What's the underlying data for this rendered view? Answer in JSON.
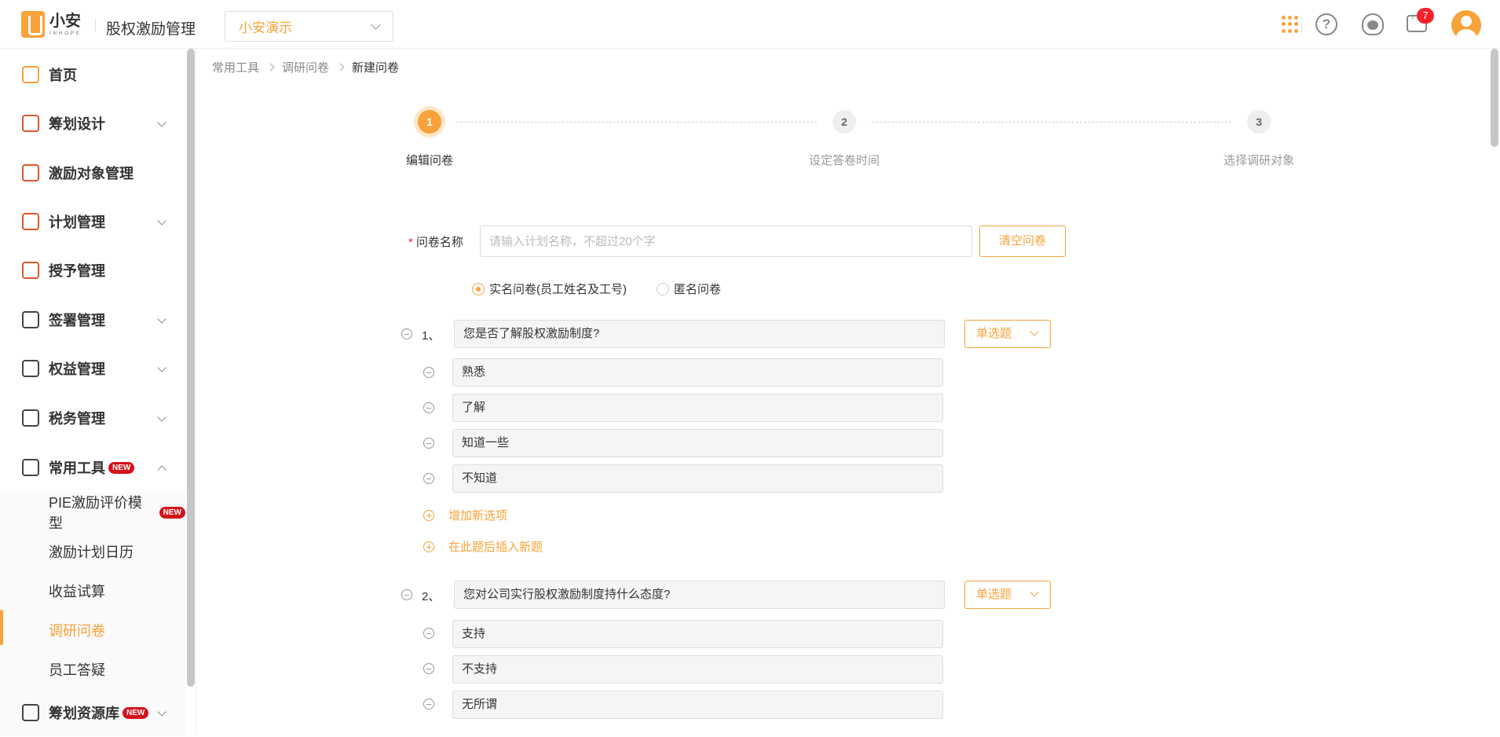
{
  "header": {
    "logo_cn": "小安",
    "logo_en": "INHOPE",
    "app_title": "股权激励管理",
    "org_selected": "小安演示",
    "help_glyph": "?",
    "message_badge": "7",
    "icons": [
      "apps-grid-icon",
      "help-icon",
      "support-headset-icon",
      "message-icon",
      "user-avatar-icon"
    ]
  },
  "sidebar": {
    "items": [
      {
        "label": "首页",
        "icon": "home-icon"
      },
      {
        "label": "筹划设计",
        "icon": "edit-icon"
      },
      {
        "label": "激励对象管理",
        "icon": "people-icon"
      },
      {
        "label": "计划管理",
        "icon": "apps-icon"
      },
      {
        "label": "授予管理",
        "icon": "document-icon"
      },
      {
        "label": "签署管理",
        "icon": "signature-icon"
      },
      {
        "label": "权益管理",
        "icon": "equity-icon"
      },
      {
        "label": "税务管理",
        "icon": "tax-icon"
      },
      {
        "label": "常用工具",
        "icon": "toolbox-icon",
        "badge": "NEW"
      },
      {
        "label": "筹划资源库",
        "icon": "layers-icon",
        "badge": "NEW"
      }
    ],
    "tools_sub": [
      {
        "label": "PIE激励评价模型",
        "badge": "NEW"
      },
      {
        "label": "激励计划日历"
      },
      {
        "label": "收益试算"
      },
      {
        "label": "调研问卷"
      },
      {
        "label": "员工答疑"
      }
    ]
  },
  "breadcrumb": [
    "常用工具",
    "调研问卷",
    "新建问卷"
  ],
  "steps": [
    {
      "num": "1",
      "label": "编辑问卷"
    },
    {
      "num": "2",
      "label": "设定答卷时间"
    },
    {
      "num": "3",
      "label": "选择调研对象"
    }
  ],
  "form": {
    "name_label": "问卷名称",
    "name_required_mark": "*",
    "name_placeholder": "请输入计划名称，不超过20个字",
    "clear_button": "清空问卷",
    "radio_realname": "实名问卷(员工姓名及工号)",
    "radio_anonymous": "匿名问卷",
    "add_option": "增加新选项",
    "insert_question": "在此题后插入新题"
  },
  "questions": [
    {
      "num": "1、",
      "text": "您是否了解股权激励制度?",
      "type": "单选题",
      "options": [
        "熟悉",
        "了解",
        "知道一些",
        "不知道"
      ]
    },
    {
      "num": "2、",
      "text": "您对公司实行股权激励制度持什么态度?",
      "type": "单选题",
      "options": [
        "支持",
        "不支持",
        "无所谓"
      ]
    }
  ],
  "colors": {
    "accent": "#f7a23a",
    "badge_red": "#d4121a"
  }
}
